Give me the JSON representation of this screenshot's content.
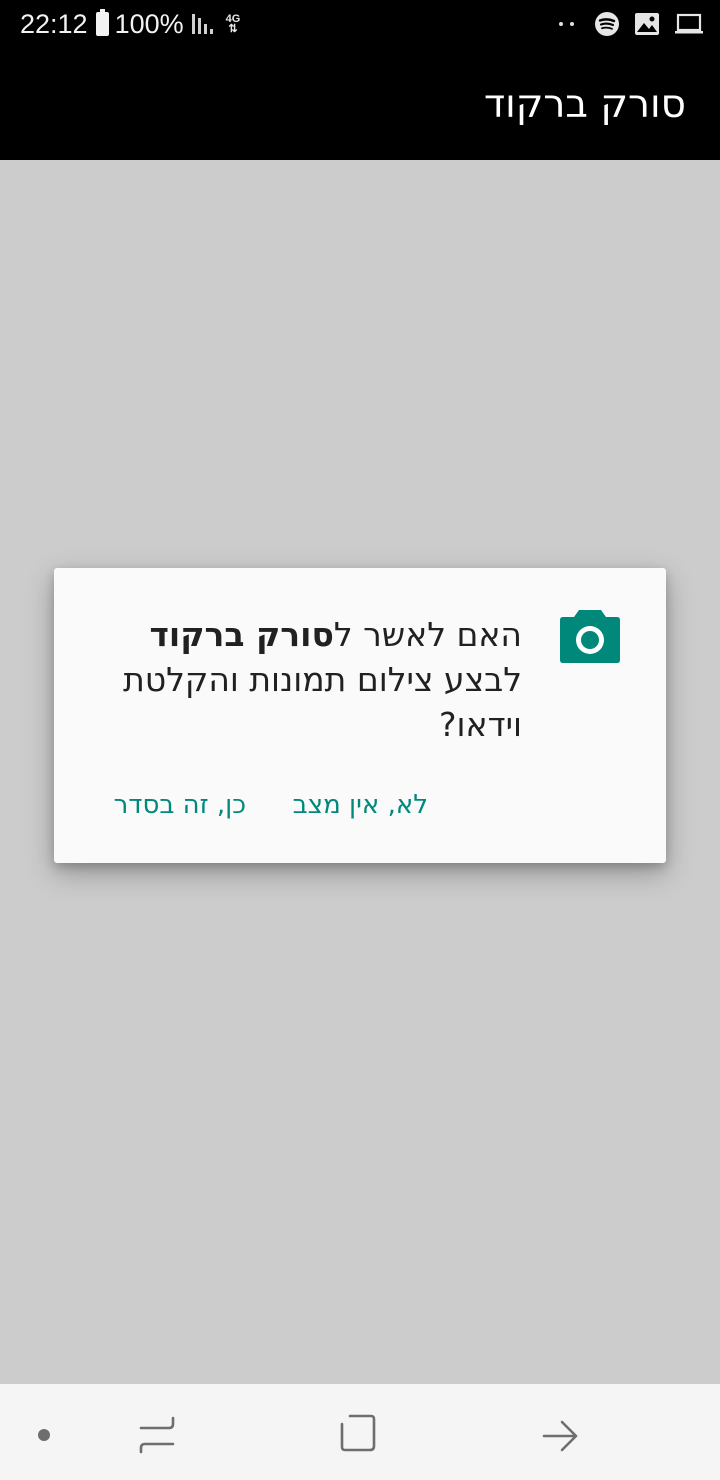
{
  "status_bar": {
    "time": "22:12",
    "battery": "100%",
    "network_type": "4G",
    "icons": [
      "battery-icon",
      "signal-icon",
      "network-4g-icon",
      "notification-dots-icon",
      "spotify-icon",
      "image-icon",
      "laptop-icon"
    ]
  },
  "app_bar": {
    "title": "סורק ברקוד"
  },
  "dialog": {
    "message_prefix": "האם לאשר ל",
    "app_name": "סורק ברקוד",
    "message_suffix": " לבצע צילום תמונות והקלטת וידאו?",
    "deny_label": "לא, אין מצב",
    "allow_label": "כן, זה בסדר",
    "icon": "camera-icon",
    "accent_color": "#00897b"
  },
  "nav_bar": {
    "icons": [
      "notification-dot-icon",
      "recents-icon",
      "home-icon",
      "back-icon"
    ]
  }
}
